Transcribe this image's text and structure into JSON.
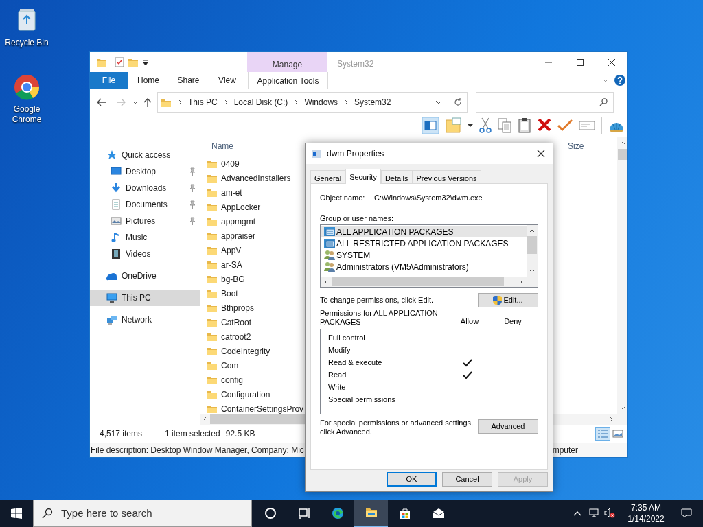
{
  "desktop_icons": [
    {
      "label": "Recycle Bin"
    },
    {
      "label": "Google Chrome"
    }
  ],
  "explorer": {
    "context_tab_group": "Manage",
    "title": "System32",
    "ribbon_tabs": [
      {
        "label": "File",
        "kind": "file",
        "selected": false
      },
      {
        "label": "Home",
        "kind": "tab",
        "selected": false
      },
      {
        "label": "Share",
        "kind": "tab",
        "selected": false
      },
      {
        "label": "View",
        "kind": "tab",
        "selected": false
      },
      {
        "label": "Application Tools",
        "kind": "context",
        "selected": true
      }
    ],
    "breadcrumb": [
      "This PC",
      "Local Disk (C:)",
      "Windows",
      "System32"
    ],
    "nav_pane": [
      {
        "label": "Quick access",
        "selected": false,
        "children": [
          {
            "label": "Desktop",
            "pinned": true,
            "selected": false
          },
          {
            "label": "Downloads",
            "pinned": true,
            "selected": false
          },
          {
            "label": "Documents",
            "pinned": true,
            "selected": false
          },
          {
            "label": "Pictures",
            "pinned": true,
            "selected": false
          },
          {
            "label": "Music",
            "pinned": false,
            "selected": false
          },
          {
            "label": "Videos",
            "pinned": false,
            "selected": false
          }
        ]
      },
      {
        "label": "OneDrive",
        "selected": false
      },
      {
        "label": "This PC",
        "selected": true
      },
      {
        "label": "Network",
        "selected": false
      }
    ],
    "columns": [
      "Name",
      "Size"
    ],
    "files": [
      "0409",
      "AdvancedInstallers",
      "am-et",
      "AppLocker",
      "appmgmt",
      "appraiser",
      "AppV",
      "ar-SA",
      "bg-BG",
      "Boot",
      "Bthprops",
      "CatRoot",
      "catroot2",
      "CodeIntegrity",
      "Com",
      "config",
      "Configuration",
      "ContainerSettingsProv"
    ],
    "status_bar": {
      "item_count": "4,517 items",
      "selection": "1 item selected",
      "size": "92.5 KB"
    },
    "details_pane": [
      "File description: Desktop Window Manager, Company: Mic",
      "mputer"
    ]
  },
  "dialog": {
    "title": "dwm Properties",
    "tabs": [
      {
        "label": "General",
        "selected": false
      },
      {
        "label": "Security",
        "selected": true
      },
      {
        "label": "Details",
        "selected": false
      },
      {
        "label": "Previous Versions",
        "selected": false
      }
    ],
    "object_name_label": "Object name:",
    "object_name": "C:\\Windows\\System32\\dwm.exe",
    "group_label": "Group or user names:",
    "groups": [
      {
        "label": "ALL APPLICATION PACKAGES",
        "kind": "package",
        "selected": true
      },
      {
        "label": "ALL RESTRICTED APPLICATION PACKAGES",
        "kind": "package",
        "selected": false
      },
      {
        "label": "SYSTEM",
        "kind": "users",
        "selected": false
      },
      {
        "label": "Administrators (VM5\\Administrators)",
        "kind": "users",
        "selected": false
      }
    ],
    "edit_hint": "To change permissions, click Edit.",
    "edit_button": "Edit...",
    "permissions_label": "Permissions for ALL APPLICATION PACKAGES",
    "allow_label": "Allow",
    "deny_label": "Deny",
    "permissions": [
      {
        "label": "Full control",
        "allow": false,
        "deny": false
      },
      {
        "label": "Modify",
        "allow": false,
        "deny": false
      },
      {
        "label": "Read & execute",
        "allow": true,
        "deny": false
      },
      {
        "label": "Read",
        "allow": true,
        "deny": false
      },
      {
        "label": "Write",
        "allow": false,
        "deny": false
      },
      {
        "label": "Special permissions",
        "allow": false,
        "deny": false
      }
    ],
    "advanced_hint": "For special permissions or advanced settings, click Advanced.",
    "advanced_button": "Advanced",
    "buttons": [
      {
        "label": "OK",
        "kind": "default",
        "disabled": false
      },
      {
        "label": "Cancel",
        "kind": "normal",
        "disabled": false
      },
      {
        "label": "Apply",
        "kind": "normal",
        "disabled": true
      }
    ]
  },
  "taskbar": {
    "search_placeholder": "Type here to search",
    "apps": [
      {
        "selected": false
      },
      {
        "selected": false
      },
      {
        "selected": false
      },
      {
        "selected": true
      },
      {
        "selected": false
      },
      {
        "selected": false
      }
    ],
    "time": "7:35 AM",
    "date": "1/14/2022"
  }
}
